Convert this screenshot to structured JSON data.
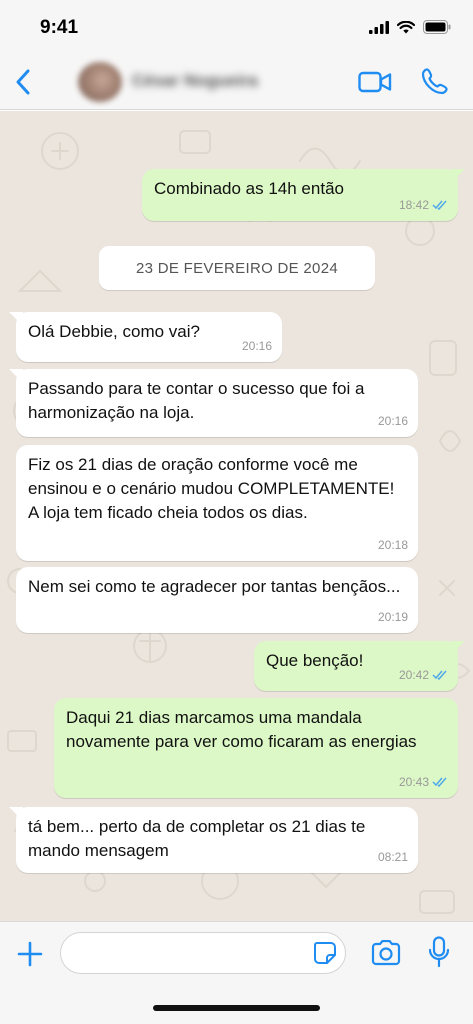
{
  "status_bar": {
    "time": "9:41"
  },
  "header": {
    "contact_name": "César Nogueira",
    "icons": [
      "chevron-left-icon",
      "video-call-icon",
      "phone-icon"
    ]
  },
  "colors": {
    "accent": "#1f8cf2",
    "outgoing_bubble": "#dcf8c6",
    "incoming_bubble": "#ffffff",
    "chat_background": "#ebe5dd",
    "read_ticks": "#4fa9ea"
  },
  "messages": [
    {
      "direction": "out",
      "text": "Combinado as 14h então",
      "time": "18:42",
      "status": "read"
    },
    {
      "direction": "in",
      "text": "Olá Debbie, como vai?",
      "time": "20:16"
    },
    {
      "direction": "in",
      "text": "Passando para te contar o sucesso que foi a harmonização na loja.",
      "time": "20:16"
    },
    {
      "direction": "in",
      "text": "Fiz os 21 dias de oração conforme você me ensinou e o cenário mudou COMPLETAMENTE! A loja tem ficado cheia todos os dias.",
      "time": "20:18"
    },
    {
      "direction": "in",
      "text": "Nem sei como te agradecer por tantas bençãos...",
      "time": "20:19"
    },
    {
      "direction": "out",
      "text": "Que benção!",
      "time": "20:42",
      "status": "read"
    },
    {
      "direction": "out",
      "text": "Daqui 21 dias marcamos uma mandala novamente para ver como ficaram as energias",
      "time": "20:43",
      "status": "read"
    },
    {
      "direction": "in",
      "text": "tá bem... perto da de completar os 21 dias te mando mensagem",
      "time": "08:21"
    }
  ],
  "date_separator": "23 DE FEVEREIRO DE 2024",
  "composer": {
    "value": "",
    "icons": [
      "plus-icon",
      "sticker-icon",
      "camera-icon",
      "microphone-icon"
    ]
  }
}
